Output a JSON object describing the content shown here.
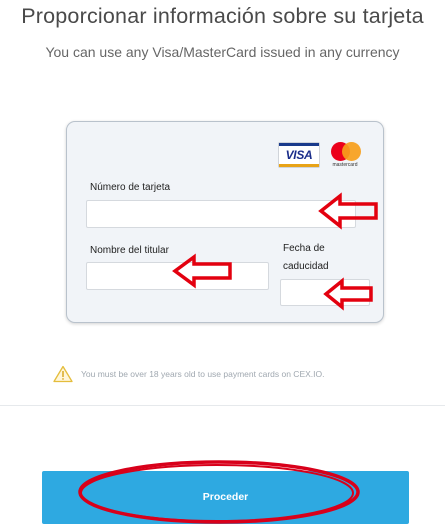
{
  "header": {
    "title": "Proporcionar información sobre su tarjeta",
    "subtitle": "You can use any Visa/MasterCard issued in any currency"
  },
  "card_form": {
    "logos": {
      "visa_label": "VISA",
      "mastercard_label": "mastercard"
    },
    "card_number_label": "Número de tarjeta",
    "card_number_value": "",
    "holder_name_label": "Nombre del titular",
    "holder_name_value": "",
    "expiry_label_line1": "Fecha de",
    "expiry_label_line2": "caducidad",
    "expiry_value": ""
  },
  "notice": {
    "icon": "warning-triangle-icon",
    "text": "You must be over 18 years old to use payment cards on CEX.IO."
  },
  "actions": {
    "proceed_label": "Proceder"
  },
  "annotations": {
    "arrow_color": "#e3000f",
    "ring_color": "#d8001a"
  },
  "colors": {
    "accent": "#2ea9e1",
    "card_bg": "#f1f4f8"
  }
}
